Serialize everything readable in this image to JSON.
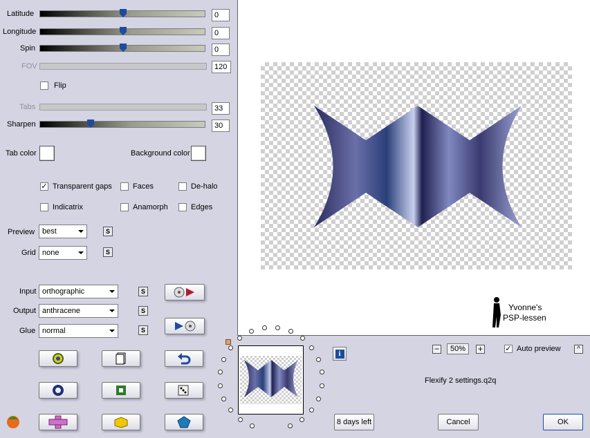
{
  "sliders": [
    {
      "label": "Latitude",
      "value": "0",
      "level": 0.5,
      "enabled": true
    },
    {
      "label": "Longitude",
      "value": "0",
      "level": 0.5,
      "enabled": true
    },
    {
      "label": "Spin",
      "value": "0",
      "level": 0.5,
      "enabled": true
    },
    {
      "label": "FOV",
      "value": "120",
      "enabled": false
    },
    {
      "label": "Tabs",
      "value": "33",
      "enabled": false
    },
    {
      "label": "Sharpen",
      "value": "30",
      "level": 0.3,
      "enabled": true
    }
  ],
  "flip": {
    "label": "Flip",
    "checked": false
  },
  "colors": {
    "tab_label": "Tab color",
    "background_label": "Background color",
    "tab_color": "#ffffff",
    "background_color": "#ffffff"
  },
  "checkboxes": {
    "transparent_gaps": {
      "label": "Transparent gaps",
      "checked": true
    },
    "faces": {
      "label": "Faces",
      "checked": false
    },
    "de_halo": {
      "label": "De-halo",
      "checked": false
    },
    "indicatrix": {
      "label": "Indicatrix",
      "checked": false
    },
    "anamorph": {
      "label": "Anamorph",
      "checked": false
    },
    "edges": {
      "label": "Edges",
      "checked": false
    }
  },
  "preview": {
    "label": "Preview",
    "value": "best"
  },
  "grid": {
    "label": "Grid",
    "value": "none"
  },
  "input": {
    "label": "Input",
    "value": "orthographic"
  },
  "output": {
    "label": "Output",
    "value": "anthracene"
  },
  "glue": {
    "label": "Glue",
    "value": "normal"
  },
  "s_label": "S",
  "watermark": {
    "line1": "Yvonne's",
    "line2": "PSP-lessen"
  },
  "zoom": {
    "minus": "−",
    "value": "50%",
    "plus": "+"
  },
  "auto_preview": {
    "label": "Auto preview",
    "checked": true
  },
  "caret_label": "^",
  "info_label": "i",
  "settings_file": "Flexify 2 settings.q2q",
  "buttons": {
    "trial": "8 days left",
    "cancel": "Cancel",
    "ok": "OK"
  },
  "accent": "#1d4b9e"
}
